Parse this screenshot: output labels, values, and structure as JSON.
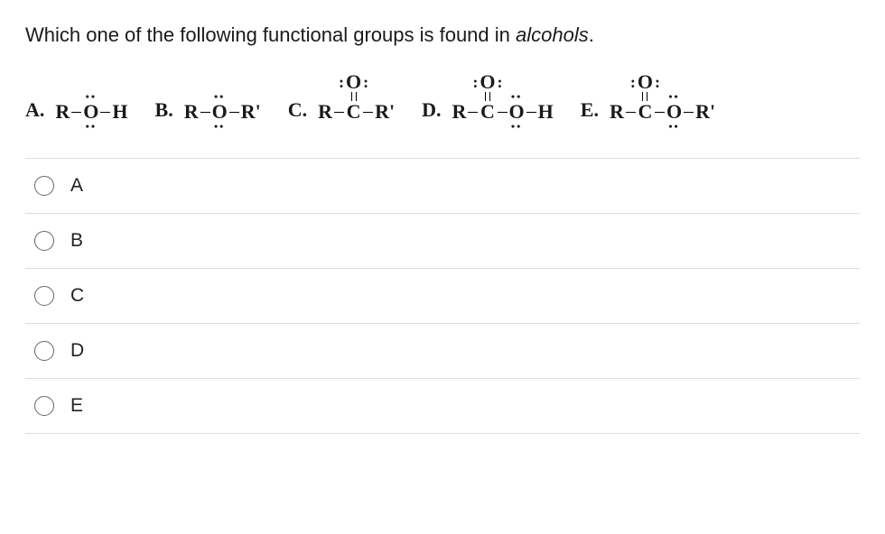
{
  "question": {
    "preText": "Which one of the following functional groups is found in ",
    "italic": "alcohols",
    "postText": "."
  },
  "formulas": {
    "A": {
      "letter": "A."
    },
    "B": {
      "letter": "B."
    },
    "C": {
      "letter": "C."
    },
    "D": {
      "letter": "D."
    },
    "E": {
      "letter": "E."
    }
  },
  "atoms": {
    "R": "R",
    "Rprime": "R'",
    "O": "O",
    "H": "H",
    "C": "C"
  },
  "options": {
    "A": "A",
    "B": "B",
    "C": "C",
    "D": "D",
    "E": "E"
  }
}
